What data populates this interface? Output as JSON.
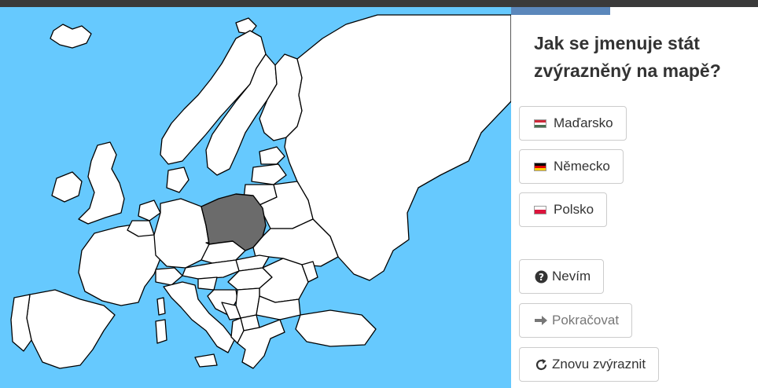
{
  "quiz": {
    "question": "Jak se jmenuje stát zvýrazněný na mapě?"
  },
  "answers": [
    {
      "label": "Maďarsko",
      "flag": "hungary-flag-icon",
      "flag_colors": [
        "#ce2939",
        "#ffffff",
        "#477050"
      ]
    },
    {
      "label": "Německo",
      "flag": "germany-flag-icon",
      "flag_colors": [
        "#000000",
        "#dd0000",
        "#ffce00"
      ]
    },
    {
      "label": "Polsko",
      "flag": "poland-flag-icon",
      "flag_colors": [
        "#ffffff",
        "#dc143c"
      ]
    }
  ],
  "actions": {
    "dont_know": {
      "label": "Nevím",
      "icon": "question-circle-icon"
    },
    "continue": {
      "label": "Pokračovat",
      "icon": "arrow-right-icon",
      "disabled": true
    },
    "rehighlight": {
      "label": "Znovu zvýraznit",
      "icon": "refresh-icon"
    }
  },
  "map": {
    "highlighted_country": "Poland",
    "colors": {
      "sea": "#66c9fe",
      "land": "#ffffff",
      "border": "#000000",
      "highlight": "#6b6b6b"
    }
  }
}
